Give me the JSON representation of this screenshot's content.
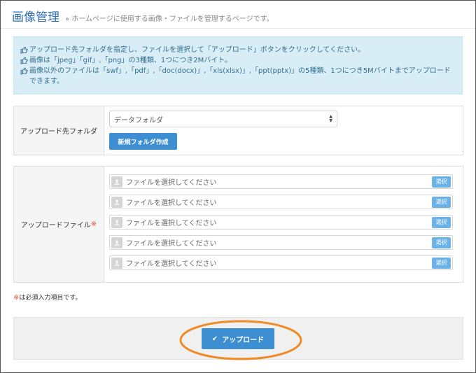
{
  "header": {
    "title": "画像管理",
    "description": "» ホームページに使用する画像・ファイルを管理するページです。"
  },
  "info": {
    "lines": [
      "アップロード先フォルダを指定し、ファイルを選択して「アップロード」ボタンをクリックしてください。",
      "画像は「jpeg」「gif」,「png」の3種類、1つにつき2Mバイト。",
      "画像以外のファイルは「swf」,「pdf」,「doc(docx)」,「xls(xlsx)」,「ppt(pptx)」の5種類、1つにつき5Mバイトまでアップロードできます。"
    ]
  },
  "folder": {
    "label": "アップロード先フォルダ",
    "selected": "データフォルダ",
    "new_folder_button": "新規フォルダ作成"
  },
  "files": {
    "label": "アップロードファイル",
    "required_mark": "※",
    "rows": [
      {
        "placeholder": "ファイルを選択してください",
        "button": "選択"
      },
      {
        "placeholder": "ファイルを選択してください",
        "button": "選択"
      },
      {
        "placeholder": "ファイルを選択してください",
        "button": "選択"
      },
      {
        "placeholder": "ファイルを選択してください",
        "button": "選択"
      },
      {
        "placeholder": "ファイルを選択してください",
        "button": "選択"
      }
    ]
  },
  "note": {
    "mark": "※",
    "text": "は必須入力項目です。"
  },
  "footer": {
    "upload_button": "アップロード",
    "check_icon": "✔"
  },
  "colors": {
    "title": "#2d6fb6",
    "info_bg": "#d9edf7",
    "info_text": "#31708f",
    "primary": "#3d8fd1",
    "select_button": "#6ab2e8",
    "required": "#e74c3c",
    "highlight": "#f08a24"
  }
}
